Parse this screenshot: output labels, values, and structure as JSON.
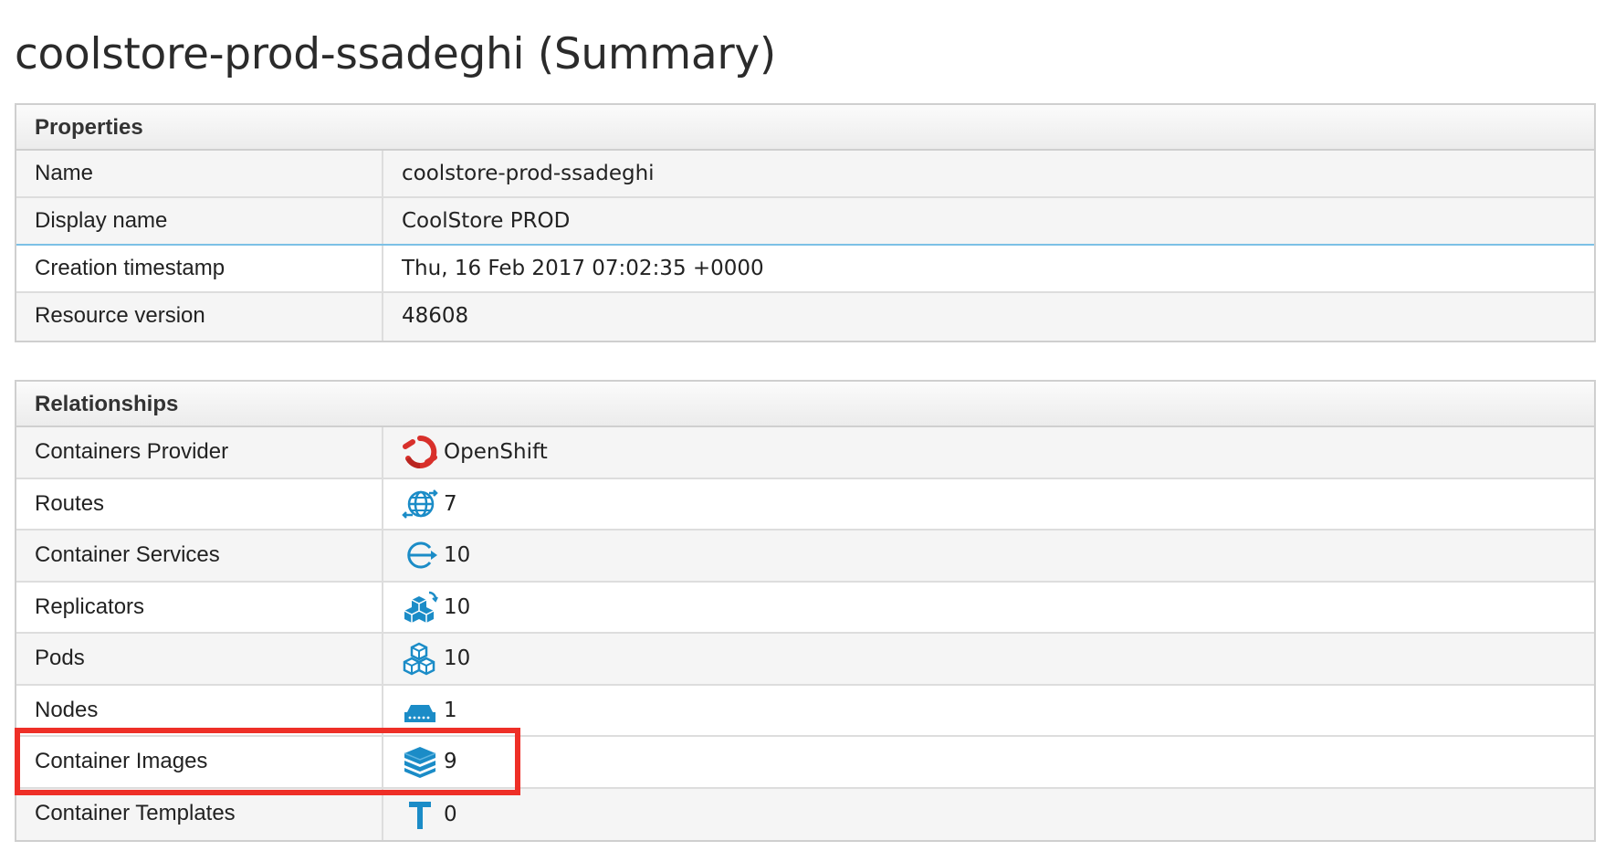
{
  "page": {
    "title": "coolstore-prod-ssadeghi (Summary)"
  },
  "properties": {
    "heading": "Properties",
    "rows": [
      {
        "label": "Name",
        "value": "coolstore-prod-ssadeghi"
      },
      {
        "label": "Display name",
        "value": "CoolStore PROD"
      },
      {
        "label": "Creation timestamp",
        "value": "Thu, 16 Feb 2017 07:02:35 +0000"
      },
      {
        "label": "Resource version",
        "value": "48608"
      }
    ]
  },
  "relationships": {
    "heading": "Relationships",
    "rows": [
      {
        "label": "Containers Provider",
        "value": "OpenShift",
        "icon": "openshift-icon"
      },
      {
        "label": "Routes",
        "value": "7",
        "icon": "routes-globe-icon"
      },
      {
        "label": "Container Services",
        "value": "10",
        "icon": "service-icon"
      },
      {
        "label": "Replicators",
        "value": "10",
        "icon": "replicator-cubes-icon"
      },
      {
        "label": "Pods",
        "value": "10",
        "icon": "pod-cubes-icon"
      },
      {
        "label": "Nodes",
        "value": "1",
        "icon": "server-node-icon"
      },
      {
        "label": "Container Images",
        "value": "9",
        "icon": "image-layers-icon"
      },
      {
        "label": "Container Templates",
        "value": "0",
        "icon": "template-t-icon"
      }
    ]
  },
  "colors": {
    "icon_blue": "#1b8cc7",
    "openshift_red": "#d8302b",
    "highlight_red": "#ee2f27",
    "row_divider_focus": "#7cc1e6"
  }
}
